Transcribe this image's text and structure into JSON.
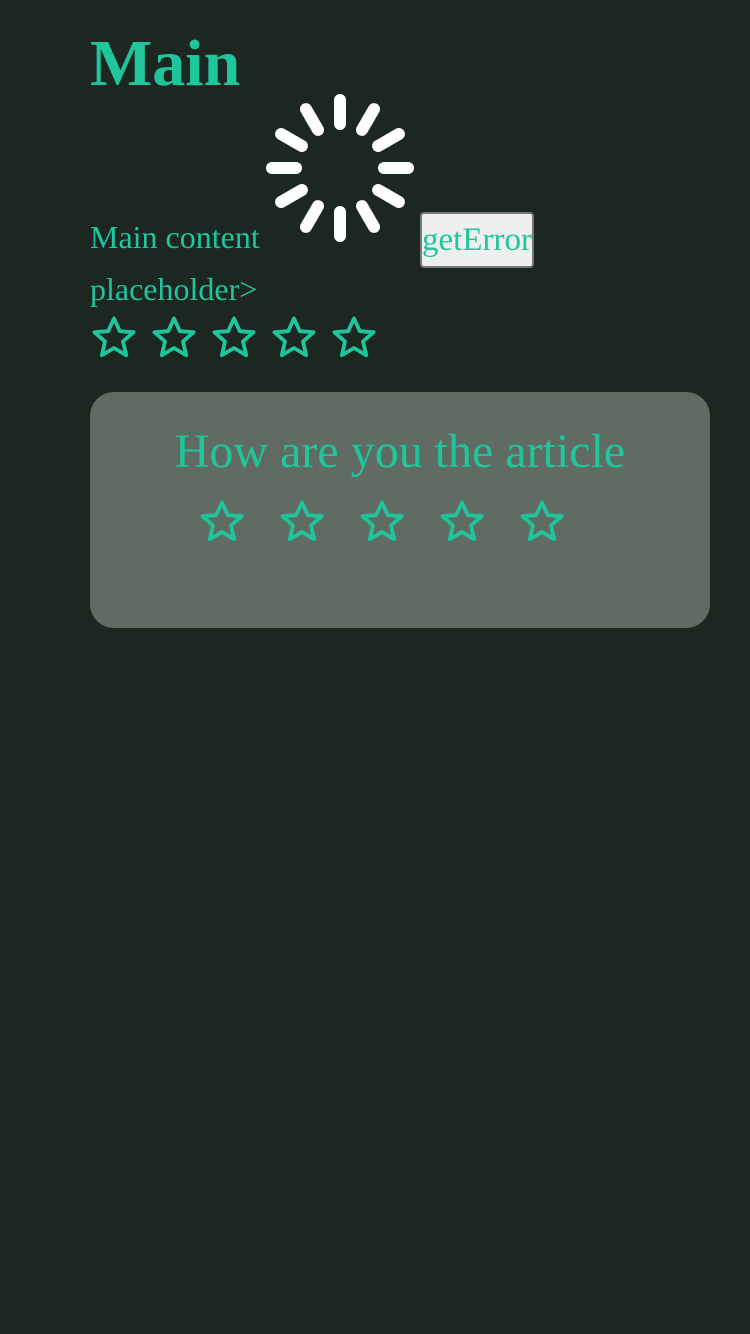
{
  "page": {
    "title": "Main",
    "content_text": "Main content placeholder>",
    "error_button_label": "getError"
  },
  "rating_stars": {
    "count": 5,
    "selected": 0,
    "icon": "star-outline-icon"
  },
  "rating_card": {
    "question": "How are you the article",
    "count": 5,
    "selected": 0,
    "icon": "star-outline-icon"
  },
  "colors": {
    "background": "#1c2722",
    "accent": "#1fc69c",
    "card_background": "#5f6b63",
    "spinner": "#ffffff",
    "button_background": "#efefef",
    "button_border": "#767676"
  }
}
